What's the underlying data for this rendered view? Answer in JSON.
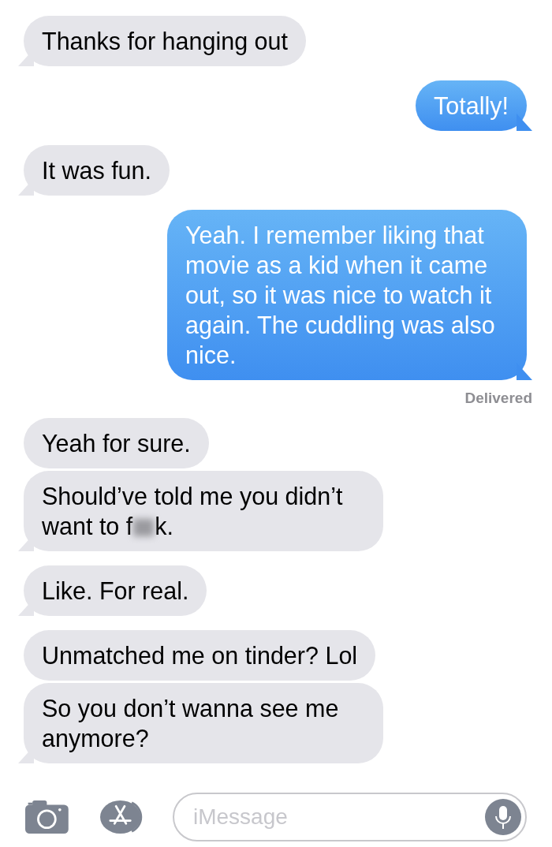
{
  "messages": [
    {
      "kind": "received",
      "text": "Thanks for hanging out",
      "tail": true
    },
    {
      "kind": "sent",
      "text": "Totally!",
      "tail": true
    },
    {
      "kind": "received",
      "text": "It was fun.",
      "tail": true
    },
    {
      "kind": "sent",
      "text": "Yeah. I remember liking that movie as a kid when it came out, so it was nice to watch it again. The cuddling was also nice.",
      "tail": true,
      "status": "Delivered"
    },
    {
      "kind": "received",
      "text": "Yeah for sure.",
      "tail": false
    },
    {
      "kind": "received",
      "text": "Should’ve told me you didn’t want to f",
      "censored": true,
      "text_after": "k.",
      "tail": true
    },
    {
      "kind": "received",
      "text": "Like. For real.",
      "tail": true
    },
    {
      "kind": "received",
      "text": "Unmatched me on tinder? Lol",
      "tail": false
    },
    {
      "kind": "received",
      "text": "So you don’t wanna see me anymore?",
      "tail": true
    }
  ],
  "compose": {
    "placeholder": "iMessage"
  }
}
